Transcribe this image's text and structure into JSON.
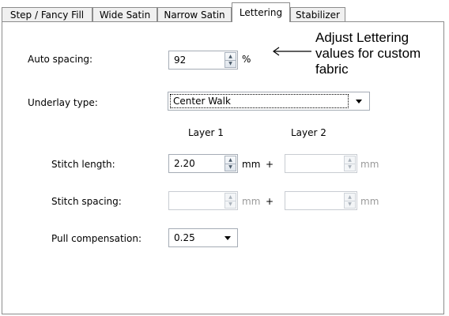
{
  "tabs": [
    {
      "label": "Step / Fancy Fill",
      "active": false
    },
    {
      "label": "Wide Satin",
      "active": false
    },
    {
      "label": "Narrow Satin",
      "active": false
    },
    {
      "label": "Lettering",
      "active": true
    },
    {
      "label": "Stabilizer",
      "active": false
    }
  ],
  "form": {
    "auto_spacing": {
      "label": "Auto spacing:",
      "value": "92",
      "unit": "%"
    },
    "underlay_type": {
      "label": "Underlay type:",
      "selected": "Center Walk"
    },
    "layer_headers": {
      "layer1": "Layer 1",
      "layer2": "Layer 2"
    },
    "stitch_length": {
      "label": "Stitch length:",
      "layer1_value": "2.20",
      "unit": "mm",
      "plus": "+",
      "layer2_value": "",
      "layer2_unit": "mm"
    },
    "stitch_spacing": {
      "label": "Stitch spacing:",
      "layer1_value": "",
      "unit": "mm",
      "plus": "+",
      "layer2_value": "",
      "layer2_unit": "mm"
    },
    "pull_compensation": {
      "label": "Pull compensation:",
      "selected": "0.25"
    }
  },
  "callout": {
    "text": "Adjust Lettering\nvalues for custom\nfabric"
  }
}
